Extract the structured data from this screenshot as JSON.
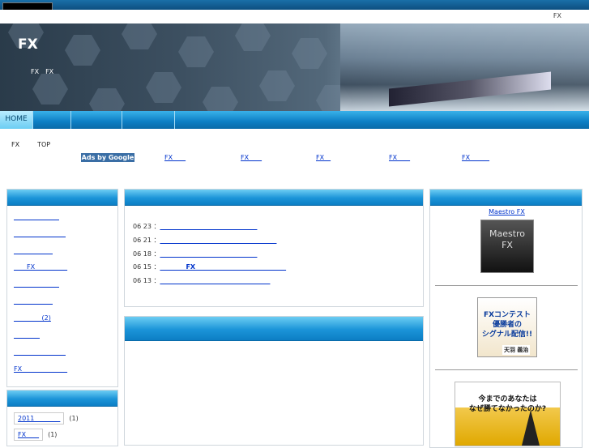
{
  "topline": {
    "text": "FX"
  },
  "header": {
    "title": "FX",
    "desc": "FX　FX"
  },
  "nav": {
    "home": "HOME"
  },
  "breadcrumb": [
    "FX",
    "TOP"
  ],
  "ads": {
    "label": "Ads by Google",
    "links": [
      "FX　　",
      "FX　　",
      "FX　",
      "FX　　",
      "FX　　　"
    ]
  },
  "sidebar_left": {
    "categories": [
      "　　　　　　　",
      "　　　　　　　　",
      "　　　　　　",
      "　　FX　　　　　",
      "　　　　　　　",
      "　　　　　　",
      "　　　　 (2)",
      "　　　　",
      "　　　　　　　　",
      "FX　　　　　　　"
    ],
    "archives": [
      {
        "label": "2011　　　　",
        "count": "(1)"
      },
      {
        "label": "FX　　",
        "count": "(1)"
      }
    ]
  },
  "main": {
    "posts": [
      {
        "date": "06 23 ：",
        "title": "　　　　　　　　　　　　　　　"
      },
      {
        "date": "06 21 ：",
        "title": "　　　　　　　　　　　　　　　　　　"
      },
      {
        "date": "06 18 ：",
        "title": "　　　　　　　　　　　　　　　"
      },
      {
        "date": "06 15 ：",
        "title": "　　　　FX　　　　　　　　　　　　　　"
      },
      {
        "date": "06 13 ：",
        "title": "　　　　　　　　　　　　　　　　　"
      }
    ]
  },
  "sidebar_right": {
    "maestro_link": "Maestro FX",
    "maestro_logo": "Maestro\nFX",
    "contest_banner": "FXコンテスト\n優勝者の\nシグナル配信!!",
    "contest_name": "天羽 義治",
    "promo_banner": "今までのあなたは\nなぜ勝てなかったのか?"
  },
  "colors": {
    "nav": "#0c7ec4",
    "box_header": "#1b94d8",
    "link": "#0033cc"
  }
}
